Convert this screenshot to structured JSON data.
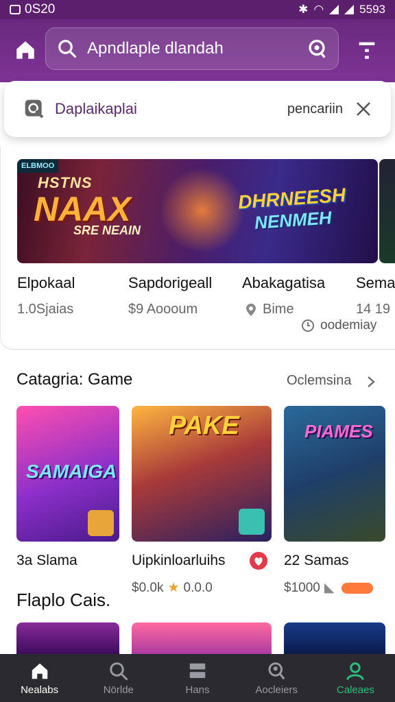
{
  "status_bar": {
    "time": "0S20",
    "battery": "5593"
  },
  "header": {
    "search_text": "Apndlaple dlandah"
  },
  "suggestion": {
    "query": "Daplaikaplai",
    "right_label": "pencariin"
  },
  "featured": {
    "banner": {
      "tag": "ELBMOO",
      "line1": "HSTNS",
      "line2": "NAAX",
      "line3": "SRE NEAIN",
      "line4": "DHRNEESH",
      "line5": "NENMEH"
    },
    "items": [
      {
        "name": "Elpokaal",
        "meta": "1.0Sjaias"
      },
      {
        "name": "Sapdorigeall",
        "meta": "$9 Aoooum"
      },
      {
        "name": "Abakagatisa",
        "meta": "Bime"
      },
      {
        "name": "Sema",
        "meta": "14 19"
      }
    ],
    "clock_label": "oodemiay"
  },
  "category": {
    "title": "Catagria: Game",
    "more": "Oclemsina",
    "tiles": [
      {
        "art": "SAMAIGA",
        "name": "3a Slama",
        "meta": ""
      },
      {
        "art": "PAKE",
        "name": "Uipkinloarluihs",
        "meta_price": "$0.0k",
        "meta_rating": "0.0.0"
      },
      {
        "art": "PIAMES",
        "name": "22 Samas",
        "meta": "$1000"
      }
    ]
  },
  "section2": {
    "title": "Flaplo Cais."
  },
  "bottom_nav": [
    {
      "label": "Nealabs",
      "icon": "home-icon"
    },
    {
      "label": "Nörlde",
      "icon": "search-icon"
    },
    {
      "label": "Hans",
      "icon": "layers-icon"
    },
    {
      "label": "Aocleiers",
      "icon": "search-person-icon"
    },
    {
      "label": "Caleaes",
      "icon": "profile-icon"
    }
  ],
  "colors": {
    "header": "#6a2a7f",
    "nav": "#2a2a30",
    "active_green": "#2ac07a"
  }
}
